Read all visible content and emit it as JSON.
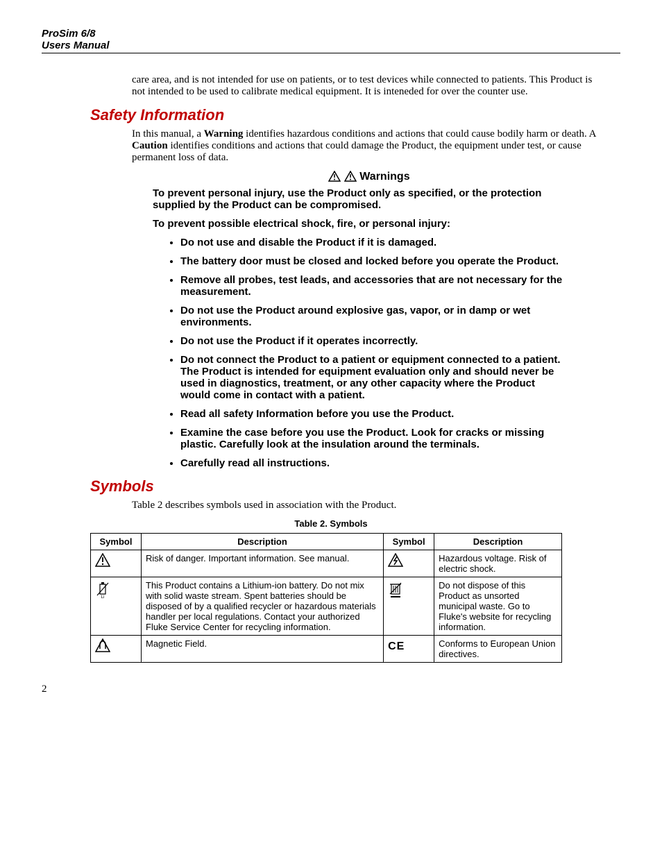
{
  "header": {
    "line1": "ProSim 6/8",
    "line2": "Users Manual"
  },
  "intro_continuation": "care area, and is not intended for use on patients, or to test devices while connected to patients. This Product is not intended to be used to calibrate medical equipment. It is inteneded for over the counter use.",
  "safety": {
    "title": "Safety Information",
    "intro_prefix": "In this manual, a ",
    "warning_word": "Warning",
    "intro_mid": " identifies hazardous conditions and actions that could cause bodily harm or death. A ",
    "caution_word": "Caution",
    "intro_suffix": " identifies conditions and actions that could damage the Product, the equipment under test, or cause permanent loss of data.",
    "warnings_heading": "Warnings",
    "warn_para1": "To prevent personal injury, use the Product only as specified, or the protection supplied by the Product can be compromised.",
    "warn_para2": "To prevent possible electrical shock, fire, or personal injury:",
    "items": [
      "Do not use and disable the Product if it is damaged.",
      "The battery door must be closed and locked before you operate the Product.",
      "Remove all probes, test leads, and accessories that are not necessary for the measurement.",
      "Do not use the Product around explosive gas, vapor, or in damp or wet environments.",
      "Do not use the Product if it operates incorrectly.",
      "Do not connect the Product to a patient or equipment connected to a patient. The Product is intended for equipment evaluation only and should never be used in diagnostics, treatment, or any other capacity where the Product would come in contact with a patient.",
      "Read all safety Information before you use the Product.",
      "Examine the case before you use the Product. Look for cracks or missing plastic. Carefully look at the insulation around the terminals.",
      "Carefully read all instructions."
    ]
  },
  "symbols": {
    "title": "Symbols",
    "intro": "Table 2 describes symbols used in association with the Product.",
    "table_caption": "Table 2. Symbols",
    "headers": {
      "symbol": "Symbol",
      "description": "Description"
    },
    "rows": [
      {
        "sym_a_name": "warning-triangle-icon",
        "desc_a": "Risk of danger. Important information. See manual.",
        "sym_b_name": "hazard-voltage-icon",
        "desc_b": "Hazardous voltage. Risk of electric shock."
      },
      {
        "sym_a_name": "lithium-battery-icon",
        "desc_a": "This Product contains a Lithium-ion battery. Do not mix with solid waste stream. Spent batteries should be disposed of by a qualified recycler or hazardous materials handler per local regulations. Contact your authorized Fluke Service Center for recycling information.",
        "sym_b_name": "weee-bin-icon",
        "desc_b": "Do not dispose of this Product as unsorted municipal waste. Go to Fluke's website for recycling information."
      },
      {
        "sym_a_name": "magnetic-field-icon",
        "desc_a": "Magnetic Field.",
        "sym_b_name": "ce-mark-icon",
        "desc_b": "Conforms to European Union directives."
      }
    ]
  },
  "page_number": "2"
}
